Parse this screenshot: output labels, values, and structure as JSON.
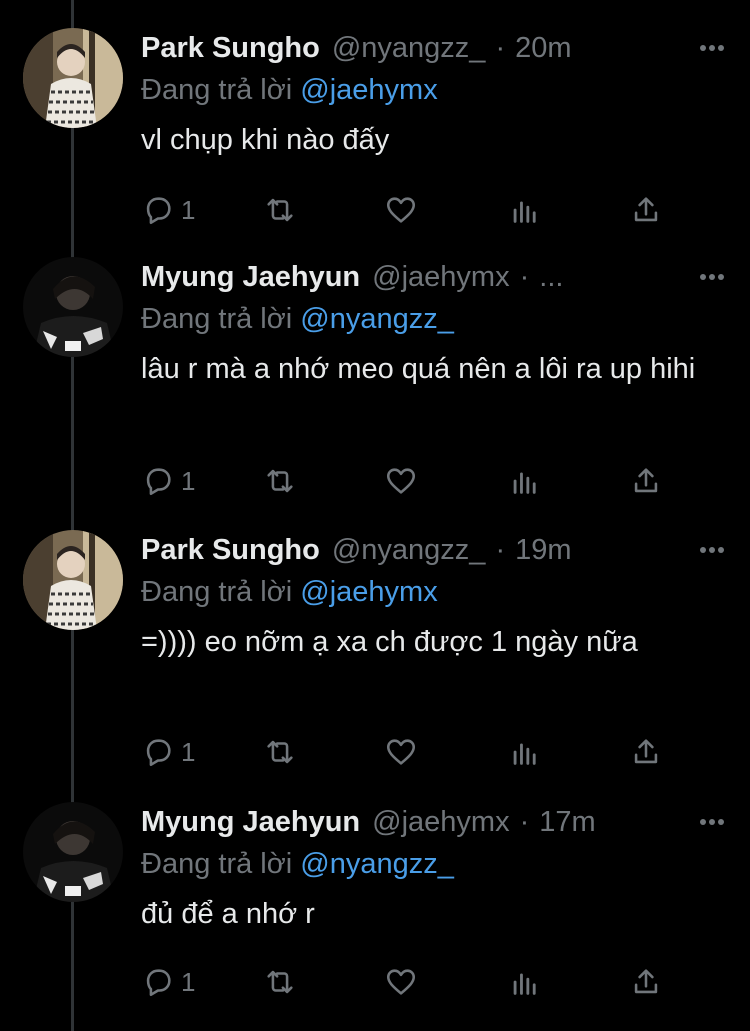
{
  "colors": {
    "background": "#000000",
    "text": "#e7e9ea",
    "muted": "#71767b",
    "mention": "#4a9ee8",
    "thread_line": "#2f3336"
  },
  "reply_prefix": "Đang trả lời",
  "icons": [
    "reply-icon",
    "retweet-icon",
    "like-icon",
    "analytics-icon",
    "share-icon",
    "more-icon"
  ],
  "tweets": [
    {
      "name": "Park Sungho",
      "handle": "@nyangzz_",
      "separator": "·",
      "time": "20m",
      "reply_to": "@jaehymx",
      "text": "vl chụp khi nào đấy",
      "reply_count": "1"
    },
    {
      "name": "Myung Jaehyun",
      "handle": "@jaehymx",
      "separator": "·",
      "time": "...",
      "reply_to": "@nyangzz_",
      "text": "lâu r mà a nhớ meo quá nên a lôi ra up hihi",
      "reply_count": "1"
    },
    {
      "name": "Park Sungho",
      "handle": "@nyangzz_",
      "separator": "·",
      "time": "19m",
      "reply_to": "@jaehymx",
      "text": "=)))) eo nỡm ạ xa ch được 1 ngày nữa",
      "reply_count": "1"
    },
    {
      "name": "Myung Jaehyun",
      "handle": "@jaehymx",
      "separator": "·",
      "time": "17m",
      "reply_to": "@nyangzz_",
      "text": "đủ để a nhớ r",
      "reply_count": "1"
    }
  ]
}
